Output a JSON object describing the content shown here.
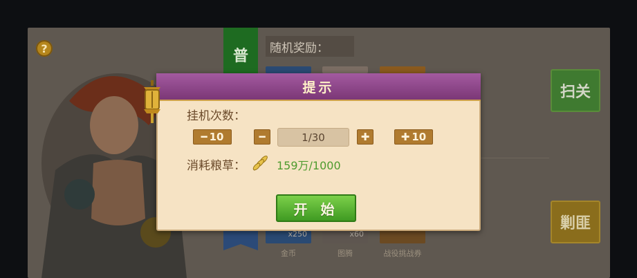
{
  "background": {
    "help_icon": "?",
    "tab_label": "普",
    "rewards_label": "随机奖励：",
    "sweep_button": "扫关",
    "suppress_button": "剿匪",
    "reward_items": [
      {
        "name": "金币",
        "count": "x250"
      },
      {
        "name": "图腾",
        "count": "x60"
      },
      {
        "name": "战役挑战券",
        "count": ""
      }
    ]
  },
  "dialog": {
    "title": "提示",
    "count_label": "挂机次数：",
    "minus10_label": "10",
    "quantity_value": "1/30",
    "plus10_label": "10",
    "cost_label": "消耗粮草：",
    "cost_value": "159万/1000",
    "start_button": "开 始"
  },
  "colors": {
    "header_purple": "#8e4689",
    "dialog_bg": "#f6e3c4",
    "start_green": "#5cb634",
    "cost_green": "#4e9b2e",
    "step_brown": "#b07b2f"
  }
}
